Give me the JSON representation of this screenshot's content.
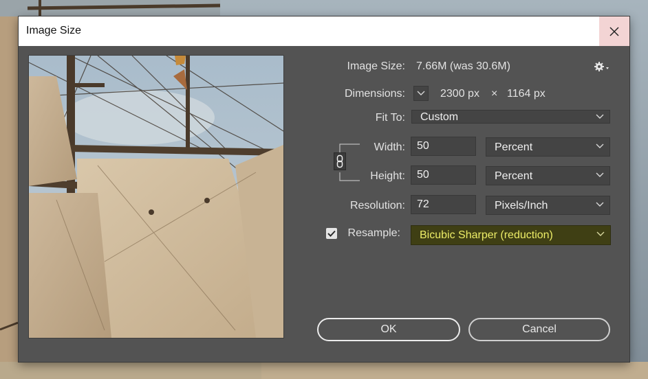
{
  "window": {
    "title": "Image Size"
  },
  "info": {
    "image_size_label": "Image Size:",
    "image_size_value": "7.66M (was 30.6M)",
    "dimensions_label": "Dimensions:",
    "dimensions_width": "2300 px",
    "dimensions_sep": "×",
    "dimensions_height": "1164 px"
  },
  "fit_to": {
    "label": "Fit To:",
    "value": "Custom"
  },
  "width": {
    "label": "Width:",
    "value": "50",
    "unit": "Percent"
  },
  "height": {
    "label": "Height:",
    "value": "50",
    "unit": "Percent"
  },
  "resolution": {
    "label": "Resolution:",
    "value": "72",
    "unit": "Pixels/Inch"
  },
  "resample": {
    "label": "Resample:",
    "checked": true,
    "method": "Bicubic Sharper (reduction)"
  },
  "buttons": {
    "ok": "OK",
    "cancel": "Cancel"
  },
  "icons": {
    "close": "close-icon",
    "settings": "gear-icon",
    "chain": "chain-link-icon",
    "chevron": "chevron-down-icon",
    "checkbox": "checkmark-icon"
  },
  "colors": {
    "dialog_bg": "#535353",
    "field_bg": "#444444",
    "highlight_text": "#eded67",
    "highlight_bg": "#3f3f14",
    "close_bg": "#f3d4d4"
  }
}
